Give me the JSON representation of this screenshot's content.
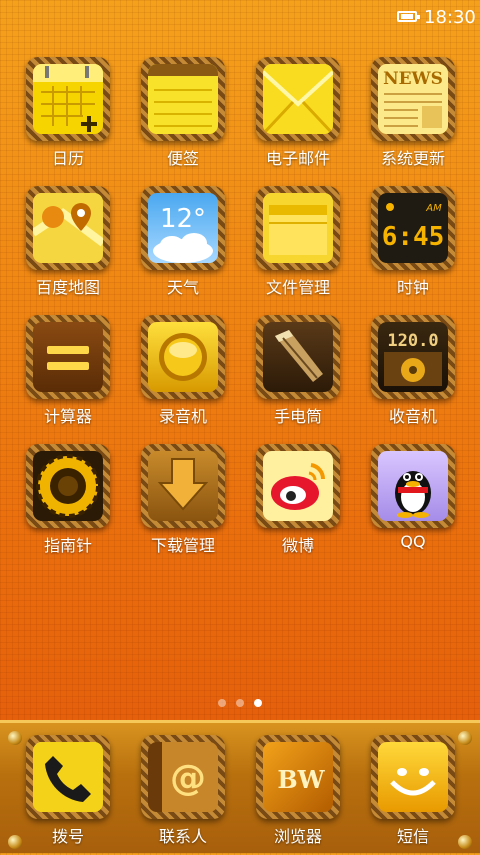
{
  "status_bar": {
    "time": "18:30",
    "battery_icon": "battery-icon"
  },
  "apps": [
    {
      "id": "calendar",
      "label": "日历",
      "icon": "calendar-icon"
    },
    {
      "id": "notes",
      "label": "便签",
      "icon": "notes-icon"
    },
    {
      "id": "email",
      "label": "电子邮件",
      "icon": "envelope-icon"
    },
    {
      "id": "system-update",
      "label": "系统更新",
      "icon": "news-icon",
      "icon_text": "NEWS"
    },
    {
      "id": "baidu-map",
      "label": "百度地图",
      "icon": "map-pin-icon"
    },
    {
      "id": "weather",
      "label": "天气",
      "icon": "weather-icon",
      "icon_text": "12°"
    },
    {
      "id": "file-manager",
      "label": "文件管理",
      "icon": "folder-icon"
    },
    {
      "id": "clock",
      "label": "时钟",
      "icon": "alarm-clock-icon",
      "icon_text": "6:45",
      "icon_subtext": "AM"
    },
    {
      "id": "calculator",
      "label": "计算器",
      "icon": "equals-icon"
    },
    {
      "id": "recorder",
      "label": "录音机",
      "icon": "record-icon"
    },
    {
      "id": "flashlight",
      "label": "手电筒",
      "icon": "flashlight-icon"
    },
    {
      "id": "radio",
      "label": "收音机",
      "icon": "radio-icon",
      "icon_text": "120.0"
    },
    {
      "id": "compass",
      "label": "指南针",
      "icon": "compass-icon"
    },
    {
      "id": "download-manager",
      "label": "下载管理",
      "icon": "download-arrow-icon"
    },
    {
      "id": "weibo",
      "label": "微博",
      "icon": "weibo-icon"
    },
    {
      "id": "qq",
      "label": "QQ",
      "icon": "penguin-icon"
    }
  ],
  "page_indicator": {
    "count": 3,
    "active": 2
  },
  "dock": [
    {
      "id": "phone",
      "label": "拨号",
      "icon": "phone-icon"
    },
    {
      "id": "contacts",
      "label": "联系人",
      "icon": "at-sign-icon",
      "icon_text": "@"
    },
    {
      "id": "browser",
      "label": "浏览器",
      "icon": "browser-icon",
      "icon_text": "BW"
    },
    {
      "id": "sms",
      "label": "短信",
      "icon": "smiley-icon"
    }
  ],
  "colors": {
    "wallpaper_top": "#f5a11c",
    "wallpaper_bottom": "#e2550a",
    "tile_gold": "#f2c400",
    "tile_frame": "#7a4a14"
  }
}
